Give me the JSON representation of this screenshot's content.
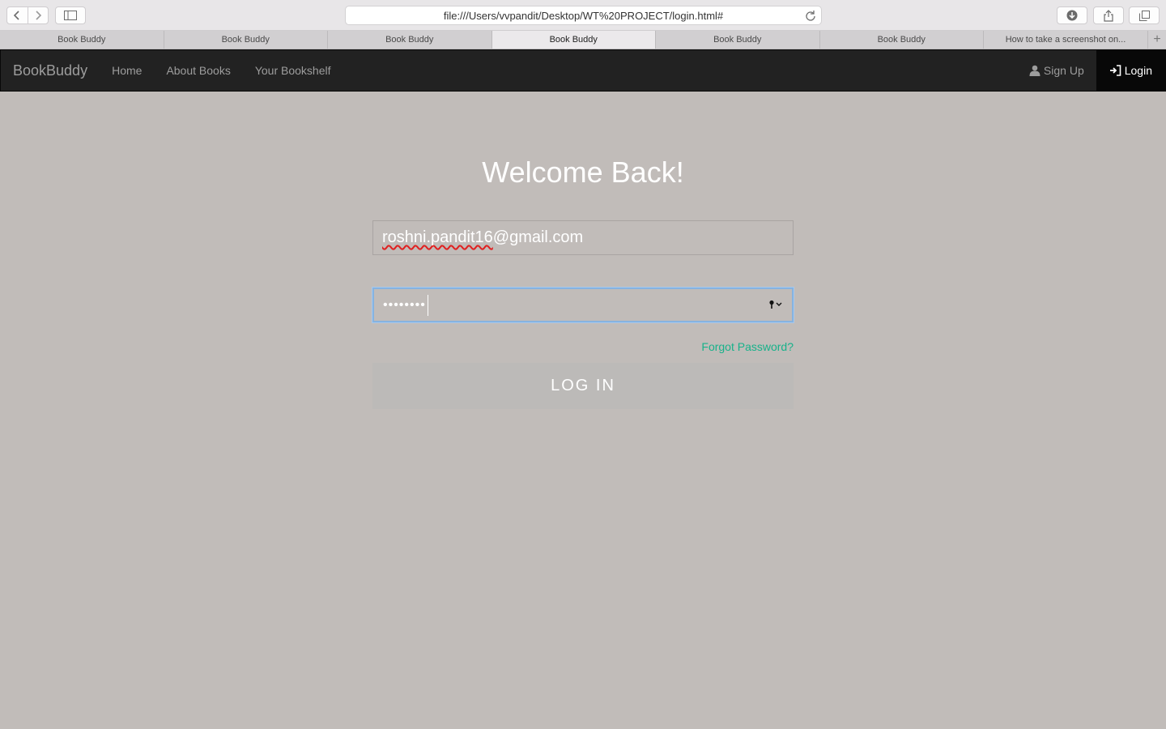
{
  "browser": {
    "url": "file:///Users/vvpandit/Desktop/WT%20PROJECT/login.html#",
    "tabs": [
      {
        "label": "Book Buddy",
        "active": false
      },
      {
        "label": "Book Buddy",
        "active": false
      },
      {
        "label": "Book Buddy",
        "active": false
      },
      {
        "label": "Book Buddy",
        "active": true
      },
      {
        "label": "Book Buddy",
        "active": false
      },
      {
        "label": "Book Buddy",
        "active": false
      },
      {
        "label": "How to take a screenshot on...",
        "active": false
      }
    ]
  },
  "navbar": {
    "brand": "BookBuddy",
    "links": [
      "Home",
      "About Books",
      "Your Bookshelf"
    ],
    "signup_label": "Sign Up",
    "login_label": "Login"
  },
  "form": {
    "title": "Welcome Back!",
    "email_user": "roshni.pandit16",
    "email_domain": "@gmail.com",
    "password_masked": "••••••••",
    "forgot_label": "Forgot Password?",
    "submit_label": "LOG IN"
  },
  "colors": {
    "background": "#c1bcb9",
    "navbar": "#222222",
    "accent_link": "#17b28a",
    "focus_ring": "#86b3e1"
  },
  "icons": [
    "back-icon",
    "forward-icon",
    "sidebar-icon",
    "reload-icon",
    "download-icon",
    "share-icon",
    "tabs-overview-icon",
    "add-tab-icon",
    "user-icon",
    "login-icon",
    "key-icon"
  ]
}
